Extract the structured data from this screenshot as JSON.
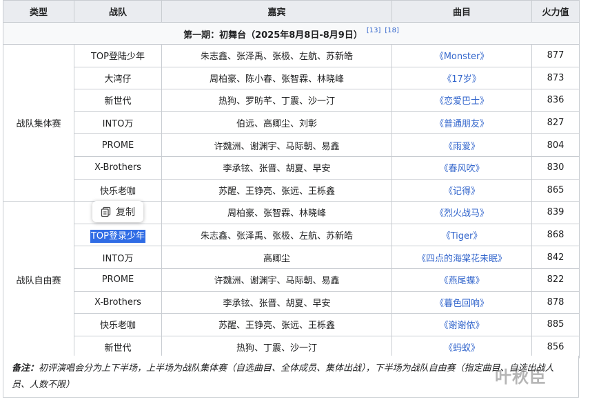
{
  "headers": [
    "类型",
    "战队",
    "嘉宾",
    "曲目",
    "火力值"
  ],
  "period": {
    "title": "第一期：初舞台（2025年8月8日-8月9日）",
    "refs": [
      "[13]",
      "[18]"
    ]
  },
  "categories": {
    "group": "战队集体赛",
    "free": "战队自由赛"
  },
  "group_rows": [
    {
      "team": "TOP登陆少年",
      "guests": "朱志鑫、张泽禹、张极、左航、苏新皓",
      "song": "《Monster》",
      "score": "877"
    },
    {
      "team": "大湾仔",
      "guests": "周柏豪、陈小春、张智霖、林晓峰",
      "song": "《17岁》",
      "score": "873"
    },
    {
      "team": "新世代",
      "guests": "热狗、罗昉芊、丁震、沙一汀",
      "song": "《恋爱巴士》",
      "score": "836"
    },
    {
      "team": "INTO万",
      "guests": "伯远、高卿尘、刘彰",
      "song": "《普通朋友》",
      "score": "827"
    },
    {
      "team": "PROME",
      "guests": "许魏洲、谢渊宇、马际朝、易鑫",
      "song": "《雨爱》",
      "score": "804"
    },
    {
      "team": "X-Brothers",
      "guests": "李承铉、张晋、胡夏、早安",
      "song": "《春风吹》",
      "score": "830"
    },
    {
      "team": "快乐老咖",
      "guests": "苏醒、王铮亮、张远、王栎鑫",
      "song": "《记得》",
      "score": "865"
    }
  ],
  "free_rows": [
    {
      "team": "",
      "guests": "周柏豪、张智霖、林晓峰",
      "song": "《烈火战马》",
      "score": "839"
    },
    {
      "team": "TOP登录少年",
      "guests": "朱志鑫、张泽禹、张极、左航、苏新皓",
      "song": "《Tiger》",
      "score": "868"
    },
    {
      "team": "INTO万",
      "guests": "高卿尘",
      "song": "《四点的海棠花未眠》",
      "score": "842"
    },
    {
      "team": "PROME",
      "guests": "许魏洲、谢渊宇、马际朝、易鑫",
      "song": "《燕尾蝶》",
      "score": "822"
    },
    {
      "team": "X-Brothers",
      "guests": "李承铉、张晋、胡夏、早安",
      "song": "《暮色回响》",
      "score": "878"
    },
    {
      "team": "快乐老咖",
      "guests": "苏醒、王铮亮、张远、王栎鑫",
      "song": "《谢谢侬》",
      "score": "885"
    },
    {
      "team": "新世代",
      "guests": "热狗、丁震、沙一汀",
      "song": "《蚂蚁》",
      "score": "856"
    }
  ],
  "note": {
    "label": "备注：",
    "text": "初评演唱会分为上下半场，上半场为战队集体赛（自选曲目、全体成员、集体出战），下半场为战队自由赛（指定曲目、自选出战人员、人数不限）"
  },
  "popup": {
    "label": "复制",
    "icon": "copy-icon"
  },
  "watermark": "叶秋臣",
  "colors": {
    "link": "#3366cc",
    "header_bg": "#eaecf0",
    "border": "#c8ccd1",
    "selection": "#2f6ce5"
  }
}
